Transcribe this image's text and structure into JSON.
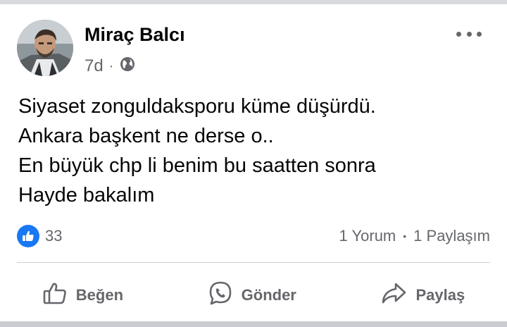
{
  "post": {
    "author": "Miraç Balcı",
    "timestamp": "7d",
    "meta_separator": "·",
    "privacy_icon": "globe-icon",
    "more_icon": "more-options-icon",
    "lines": [
      "Siyaset zonguldaksporu küme düşürdü.",
      "Ankara başkent ne derse o..",
      "En büyük chp li benim bu saatten sonra",
      "Hayde bakalım"
    ]
  },
  "stats": {
    "reaction_icon": "like-reaction-icon",
    "reaction_count": "33",
    "comments": "1 Yorum",
    "stat_separator": "•",
    "shares": "1 Paylaşım"
  },
  "actions": [
    {
      "label": "Beğen",
      "icon": "thumbs-up-icon"
    },
    {
      "label": "Gönder",
      "icon": "messenger-icon"
    },
    {
      "label": "Paylaş",
      "icon": "share-icon"
    }
  ],
  "colors": {
    "background": "#ffffff",
    "secondary_text": "#65676b",
    "like_blue": "#1877f2",
    "divider": "#ced0d4"
  }
}
